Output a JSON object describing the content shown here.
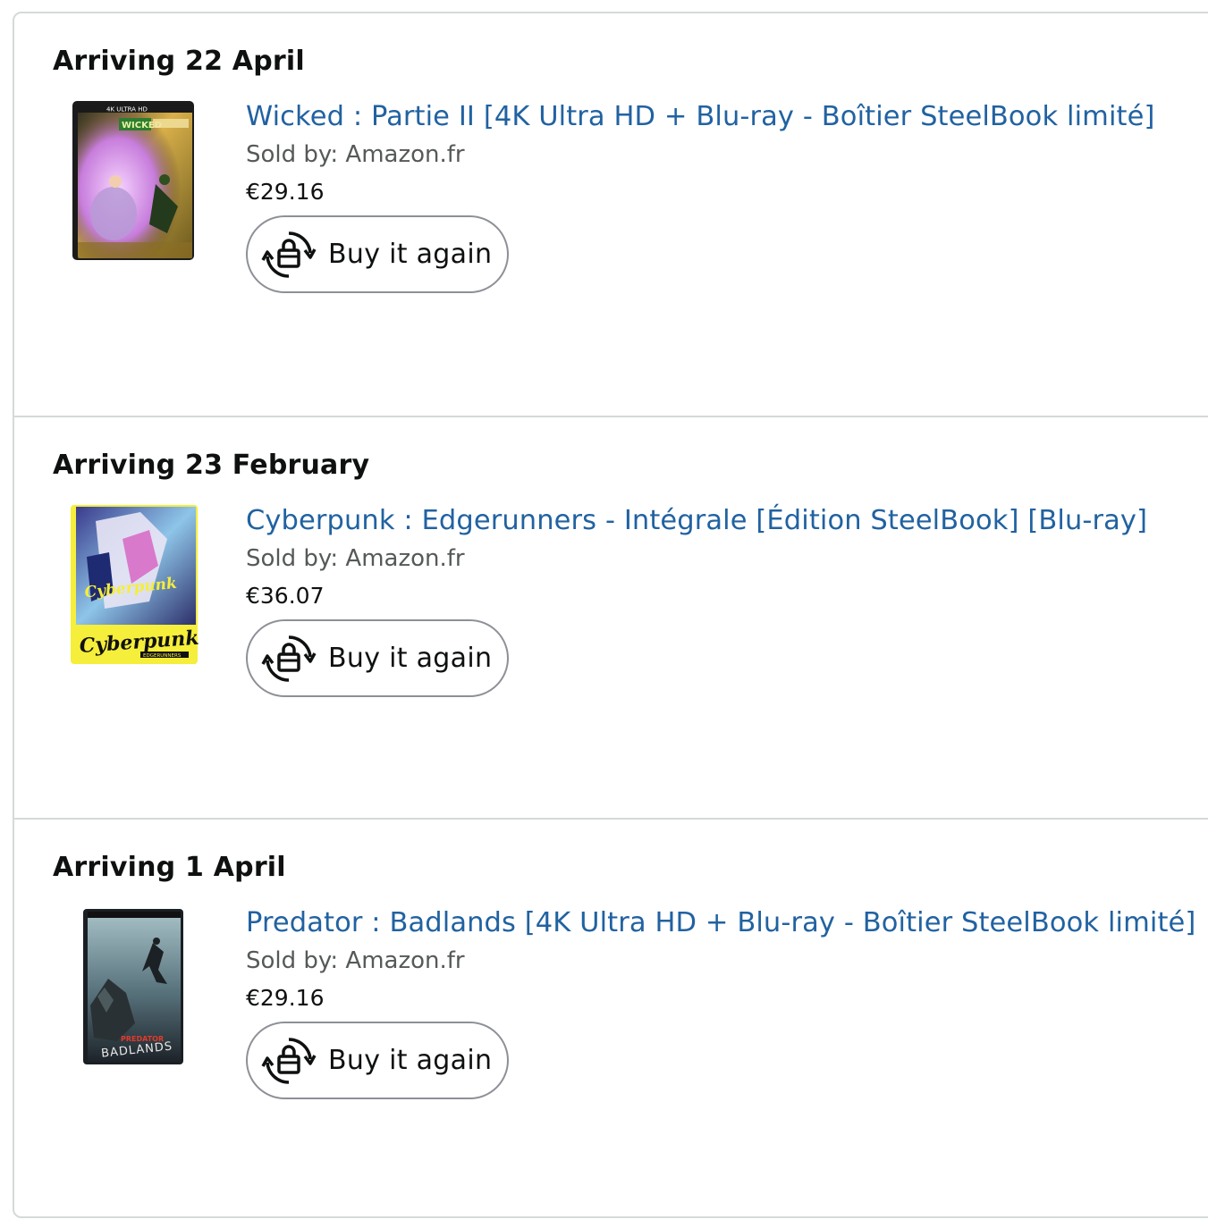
{
  "orders": [
    {
      "arriving": "Arriving 22 April",
      "title": "Wicked : Partie II [4K Ultra HD + Blu-ray - Boîtier SteelBook limité]",
      "sold_by": "Sold by: Amazon.fr",
      "price": "€29.16",
      "buy_again_label": "Buy it again",
      "cover_text_top": "4K ULTRA HD",
      "cover_text_title": "WICKED"
    },
    {
      "arriving": "Arriving 23 February",
      "title": "Cyberpunk : Edgerunners - Intégrale [Édition SteelBook] [Blu-ray]",
      "sold_by": "Sold by: Amazon.fr",
      "price": "€36.07",
      "buy_again_label": "Buy it again",
      "cover_text_title": "Cyberpunk",
      "cover_text_sub": "EDGERUNNERS"
    },
    {
      "arriving": "Arriving 1 April",
      "title": "Predator : Badlands [4K Ultra HD + Blu-ray - Boîtier SteelBook limité]",
      "sold_by": "Sold by: Amazon.fr",
      "price": "€29.16",
      "buy_again_label": "Buy it again",
      "cover_text_title": "PREDATOR",
      "cover_text_sub": "BADLANDS"
    }
  ],
  "icons": {
    "buy_again": "bag-refresh-icon"
  },
  "colors": {
    "link": "#2162a1",
    "text": "#0f1111",
    "secondary_text": "#565959",
    "border": "#d5d9d9",
    "button_border": "#8d9096"
  }
}
